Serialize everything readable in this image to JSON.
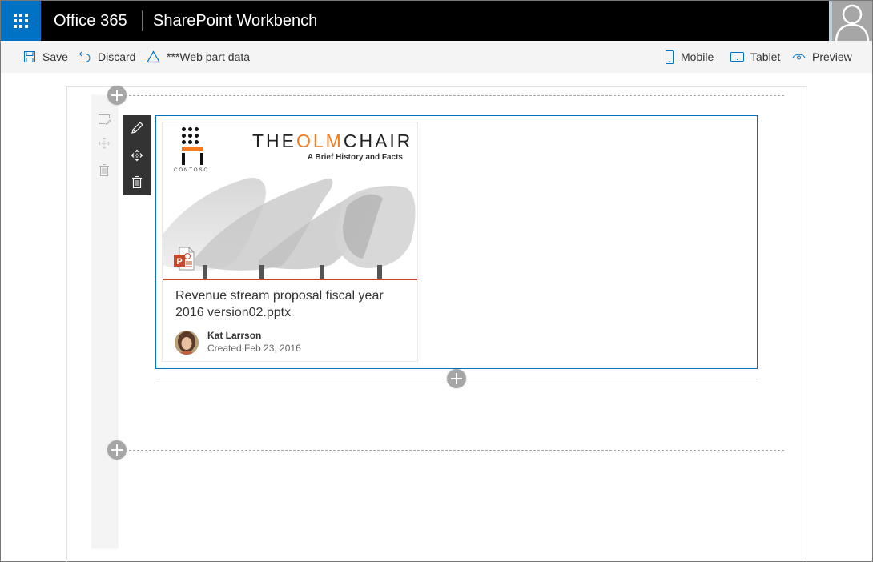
{
  "suite_bar": {
    "brand": "Office 365",
    "app_title": "SharePoint Workbench"
  },
  "command_bar": {
    "save": "Save",
    "discard": "Discard",
    "web_part_data": "***Web part data",
    "mobile": "Mobile",
    "tablet": "Tablet",
    "preview": "Preview"
  },
  "document_card": {
    "preview": {
      "logo_text": "CONTOSO",
      "title_prefix": "THE",
      "title_accent": "OLM",
      "title_suffix": "CHAIR",
      "subtitle": "A Brief History and Facts",
      "file_type_icon": "powerpoint-icon"
    },
    "title": "Revenue stream proposal fiscal year 2016 version02.pptx",
    "author": "Kat Larrson",
    "created": "Created Feb 23, 2016"
  },
  "colors": {
    "suite_bar": "#000000",
    "waffle": "#0072c6",
    "accent": "#0072c6",
    "ppt": "#c8462b",
    "olm_orange": "#f47b20"
  }
}
